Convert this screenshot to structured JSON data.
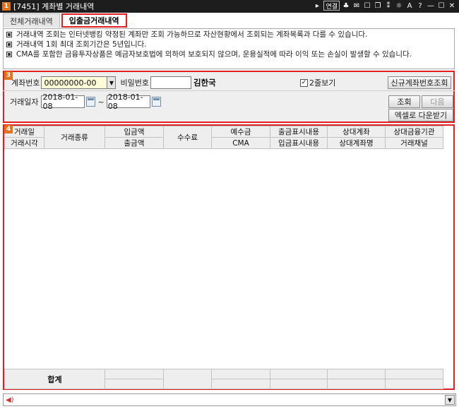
{
  "window": {
    "number": "1",
    "title": "[7451] 계좌별 거래내역",
    "tools": [
      "▸",
      "연결",
      "♣",
      "✉",
      "☐",
      "❐",
      "⁑",
      "☼",
      "A",
      "?",
      "—",
      "☐",
      "✕"
    ]
  },
  "tabs": [
    {
      "label": "전체거래내역",
      "active": false
    },
    {
      "label": "입출금거래내역",
      "active": true
    }
  ],
  "notice": [
    "거래내역 조회는 인터넷뱅킹 약정된 계좌만 조회 가능하므로 자산현황에서 조회되는 계좌목록과 다를 수 있습니다.",
    "거래내역 1회 최대 조회기간은 5년입니다.",
    "CMA를 포함한 금융투자상품은 예금자보호법에 의하여 보호되지 않으며, 운용실적에 따라 이익 또는 손실이 발생할 수 있습니다."
  ],
  "query": {
    "section_num": "3",
    "account_label": "계좌번호",
    "account_value": "00000000-00",
    "password_label": "비밀번호",
    "password_value": "",
    "owner_name": "김한국",
    "two_line_label": "2줄보기",
    "two_line_checked": "✓",
    "new_account_button": "신규계좌번호조회",
    "date_label": "거래일자",
    "date_from": "2018-01-08",
    "date_sep": "~",
    "date_to": "2018-01-08",
    "search_button": "조회",
    "next_button": "다음",
    "excel_button": "엑셀로 다운받기"
  },
  "grid": {
    "section_num": "4",
    "headers": {
      "trade_date": "거래일",
      "trade_time": "거래시각",
      "trade_type": "거래종류",
      "deposit_amount": "입금액",
      "withdraw_amount": "출금액",
      "fee": "수수료",
      "deposit_balance": "예수금",
      "cma": "CMA",
      "withdraw_display": "출금표시내용",
      "deposit_display": "입금표시내용",
      "counter_account": "상대계좌",
      "counter_account_name": "상대계좌명",
      "counter_bank": "상대금융기관",
      "trade_channel": "거래채널"
    },
    "rows": [],
    "total_label": "합계"
  }
}
